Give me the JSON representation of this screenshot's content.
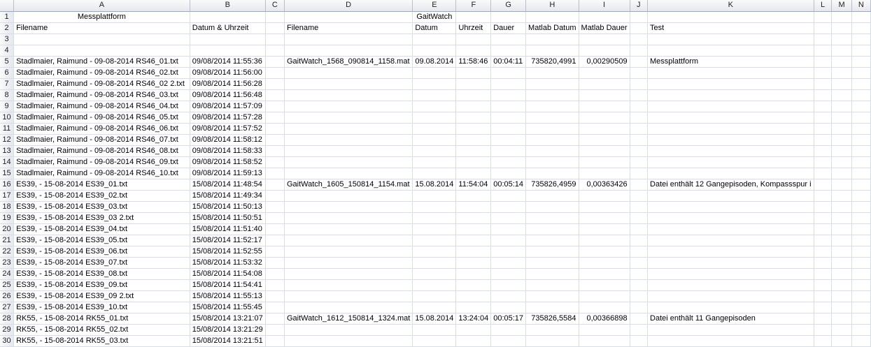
{
  "columns": [
    "A",
    "B",
    "C",
    "D",
    "E",
    "F",
    "G",
    "H",
    "I",
    "J",
    "K",
    "L",
    "M",
    "N"
  ],
  "rows": [
    {
      "n": "1",
      "A": "Messplattform",
      "B": "",
      "C": "",
      "D": "",
      "E": "GaitWatch",
      "F": "",
      "G": "",
      "H": "",
      "I": "",
      "J": "",
      "K": "",
      "L": "",
      "M": "",
      "N": ""
    },
    {
      "n": "2",
      "A": "Filename",
      "B": "Datum & Uhrzeit",
      "C": "",
      "D": "Filename",
      "E": "Datum",
      "F": "Uhrzeit",
      "G": "Dauer",
      "H": "Matlab Datum",
      "I": "Matlab Dauer",
      "J": "",
      "K": "Test",
      "L": "",
      "M": "",
      "N": ""
    },
    {
      "n": "3",
      "A": "",
      "B": "",
      "C": "",
      "D": "",
      "E": "",
      "F": "",
      "G": "",
      "H": "",
      "I": "",
      "J": "",
      "K": "",
      "L": "",
      "M": "",
      "N": ""
    },
    {
      "n": "4",
      "A": "",
      "B": "",
      "C": "",
      "D": "",
      "E": "",
      "F": "",
      "G": "",
      "H": "",
      "I": "",
      "J": "",
      "K": "",
      "L": "",
      "M": "",
      "N": ""
    },
    {
      "n": "5",
      "A": "Stadlmaier, Raimund - 09-08-2014 RS46_01.txt",
      "B": "09/08/2014 11:55:36",
      "C": "",
      "D": "GaitWatch_1568_090814_1158.mat",
      "E": "09.08.2014",
      "F": "11:58:46",
      "G": "00:04:11",
      "H": "735820,4991",
      "I": "0,00290509",
      "J": "",
      "K": "Messplattform",
      "L": "",
      "M": "",
      "N": ""
    },
    {
      "n": "6",
      "A": "Stadlmaier, Raimund - 09-08-2014 RS46_02.txt",
      "B": "09/08/2014 11:56:00",
      "C": "",
      "D": "",
      "E": "",
      "F": "",
      "G": "",
      "H": "",
      "I": "",
      "J": "",
      "K": "",
      "L": "",
      "M": "",
      "N": ""
    },
    {
      "n": "7",
      "A": "Stadlmaier, Raimund - 09-08-2014 RS46_02 2.txt",
      "B": "09/08/2014 11:56:28",
      "C": "",
      "D": "",
      "E": "",
      "F": "",
      "G": "",
      "H": "",
      "I": "",
      "J": "",
      "K": "",
      "L": "",
      "M": "",
      "N": ""
    },
    {
      "n": "8",
      "A": "Stadlmaier, Raimund - 09-08-2014 RS46_03.txt",
      "B": "09/08/2014 11:56:48",
      "C": "",
      "D": "",
      "E": "",
      "F": "",
      "G": "",
      "H": "",
      "I": "",
      "J": "",
      "K": "",
      "L": "",
      "M": "",
      "N": ""
    },
    {
      "n": "9",
      "A": "Stadlmaier, Raimund - 09-08-2014 RS46_04.txt",
      "B": "09/08/2014 11:57:09",
      "C": "",
      "D": "",
      "E": "",
      "F": "",
      "G": "",
      "H": "",
      "I": "",
      "J": "",
      "K": "",
      "L": "",
      "M": "",
      "N": ""
    },
    {
      "n": "10",
      "A": "Stadlmaier, Raimund - 09-08-2014 RS46_05.txt",
      "B": "09/08/2014 11:57:28",
      "C": "",
      "D": "",
      "E": "",
      "F": "",
      "G": "",
      "H": "",
      "I": "",
      "J": "",
      "K": "",
      "L": "",
      "M": "",
      "N": ""
    },
    {
      "n": "11",
      "A": "Stadlmaier, Raimund - 09-08-2014 RS46_06.txt",
      "B": "09/08/2014 11:57:52",
      "C": "",
      "D": "",
      "E": "",
      "F": "",
      "G": "",
      "H": "",
      "I": "",
      "J": "",
      "K": "",
      "L": "",
      "M": "",
      "N": ""
    },
    {
      "n": "12",
      "A": "Stadlmaier, Raimund - 09-08-2014 RS46_07.txt",
      "B": "09/08/2014 11:58:12",
      "C": "",
      "D": "",
      "E": "",
      "F": "",
      "G": "",
      "H": "",
      "I": "",
      "J": "",
      "K": "",
      "L": "",
      "M": "",
      "N": ""
    },
    {
      "n": "13",
      "A": "Stadlmaier, Raimund - 09-08-2014 RS46_08.txt",
      "B": "09/08/2014 11:58:33",
      "C": "",
      "D": "",
      "E": "",
      "F": "",
      "G": "",
      "H": "",
      "I": "",
      "J": "",
      "K": "",
      "L": "",
      "M": "",
      "N": ""
    },
    {
      "n": "14",
      "A": "Stadlmaier, Raimund - 09-08-2014 RS46_09.txt",
      "B": "09/08/2014 11:58:52",
      "C": "",
      "D": "",
      "E": "",
      "F": "",
      "G": "",
      "H": "",
      "I": "",
      "J": "",
      "K": "",
      "L": "",
      "M": "",
      "N": ""
    },
    {
      "n": "15",
      "A": "Stadlmaier, Raimund - 09-08-2014 RS46_10.txt",
      "B": "09/08/2014 11:59:13",
      "C": "",
      "D": "",
      "E": "",
      "F": "",
      "G": "",
      "H": "",
      "I": "",
      "J": "",
      "K": "",
      "L": "",
      "M": "",
      "N": ""
    },
    {
      "n": "16",
      "A": "ES39,   - 15-08-2014 ES39_01.txt",
      "B": "15/08/2014 11:48:54",
      "C": "",
      "D": "GaitWatch_1605_150814_1154.mat",
      "E": "15.08.2014",
      "F": "11:54:04",
      "G": "00:05:14",
      "H": "735826,4959",
      "I": "0,00363426",
      "J": "",
      "K": "Datei enthält 12 Gangepisoden, Kompassspur i",
      "L": "",
      "M": "",
      "N": ""
    },
    {
      "n": "17",
      "A": "ES39,   - 15-08-2014 ES39_02.txt",
      "B": "15/08/2014 11:49:34",
      "C": "",
      "D": "",
      "E": "",
      "F": "",
      "G": "",
      "H": "",
      "I": "",
      "J": "",
      "K": "",
      "L": "",
      "M": "",
      "N": ""
    },
    {
      "n": "18",
      "A": "ES39,   - 15-08-2014 ES39_03.txt",
      "B": "15/08/2014 11:50:13",
      "C": "",
      "D": "",
      "E": "",
      "F": "",
      "G": "",
      "H": "",
      "I": "",
      "J": "",
      "K": "",
      "L": "",
      "M": "",
      "N": ""
    },
    {
      "n": "19",
      "A": "ES39,   - 15-08-2014 ES39_03 2.txt",
      "B": "15/08/2014 11:50:51",
      "C": "",
      "D": "",
      "E": "",
      "F": "",
      "G": "",
      "H": "",
      "I": "",
      "J": "",
      "K": "",
      "L": "",
      "M": "",
      "N": ""
    },
    {
      "n": "20",
      "A": "ES39,   - 15-08-2014 ES39_04.txt",
      "B": "15/08/2014 11:51:40",
      "C": "",
      "D": "",
      "E": "",
      "F": "",
      "G": "",
      "H": "",
      "I": "",
      "J": "",
      "K": "",
      "L": "",
      "M": "",
      "N": ""
    },
    {
      "n": "21",
      "A": "ES39,   - 15-08-2014 ES39_05.txt",
      "B": "15/08/2014 11:52:17",
      "C": "",
      "D": "",
      "E": "",
      "F": "",
      "G": "",
      "H": "",
      "I": "",
      "J": "",
      "K": "",
      "L": "",
      "M": "",
      "N": ""
    },
    {
      "n": "22",
      "A": "ES39,   - 15-08-2014 ES39_06.txt",
      "B": "15/08/2014 11:52:55",
      "C": "",
      "D": "",
      "E": "",
      "F": "",
      "G": "",
      "H": "",
      "I": "",
      "J": "",
      "K": "",
      "L": "",
      "M": "",
      "N": ""
    },
    {
      "n": "23",
      "A": "ES39,   - 15-08-2014 ES39_07.txt",
      "B": "15/08/2014 11:53:32",
      "C": "",
      "D": "",
      "E": "",
      "F": "",
      "G": "",
      "H": "",
      "I": "",
      "J": "",
      "K": "",
      "L": "",
      "M": "",
      "N": ""
    },
    {
      "n": "24",
      "A": "ES39,   - 15-08-2014 ES39_08.txt",
      "B": "15/08/2014 11:54:08",
      "C": "",
      "D": "",
      "E": "",
      "F": "",
      "G": "",
      "H": "",
      "I": "",
      "J": "",
      "K": "",
      "L": "",
      "M": "",
      "N": ""
    },
    {
      "n": "25",
      "A": "ES39,   - 15-08-2014 ES39_09.txt",
      "B": "15/08/2014 11:54:41",
      "C": "",
      "D": "",
      "E": "",
      "F": "",
      "G": "",
      "H": "",
      "I": "",
      "J": "",
      "K": "",
      "L": "",
      "M": "",
      "N": ""
    },
    {
      "n": "26",
      "A": "ES39,   - 15-08-2014 ES39_09 2.txt",
      "B": "15/08/2014 11:55:13",
      "C": "",
      "D": "",
      "E": "",
      "F": "",
      "G": "",
      "H": "",
      "I": "",
      "J": "",
      "K": "",
      "L": "",
      "M": "",
      "N": ""
    },
    {
      "n": "27",
      "A": "ES39,   - 15-08-2014 ES39_10.txt",
      "B": "15/08/2014 11:55:45",
      "C": "",
      "D": "",
      "E": "",
      "F": "",
      "G": "",
      "H": "",
      "I": "",
      "J": "",
      "K": "",
      "L": "",
      "M": "",
      "N": ""
    },
    {
      "n": "28",
      "A": "RK55,   - 15-08-2014 RK55_01.txt",
      "B": "15/08/2014 13:21:07",
      "C": "",
      "D": "GaitWatch_1612_150814_1324.mat",
      "E": "15.08.2014",
      "F": "13:24:04",
      "G": "00:05:17",
      "H": "735826,5584",
      "I": "0,00366898",
      "J": "",
      "K": "Datei enthält 11 Gangepisoden",
      "L": "",
      "M": "",
      "N": ""
    },
    {
      "n": "29",
      "A": "RK55,   - 15-08-2014 RK55_02.txt",
      "B": "15/08/2014 13:21:29",
      "C": "",
      "D": "",
      "E": "",
      "F": "",
      "G": "",
      "H": "",
      "I": "",
      "J": "",
      "K": "",
      "L": "",
      "M": "",
      "N": ""
    },
    {
      "n": "30",
      "A": "RK55,   - 15-08-2014 RK55_03.txt",
      "B": "15/08/2014 13:21:51",
      "C": "",
      "D": "",
      "E": "",
      "F": "",
      "G": "",
      "H": "",
      "I": "",
      "J": "",
      "K": "",
      "L": "",
      "M": "",
      "N": ""
    }
  ]
}
